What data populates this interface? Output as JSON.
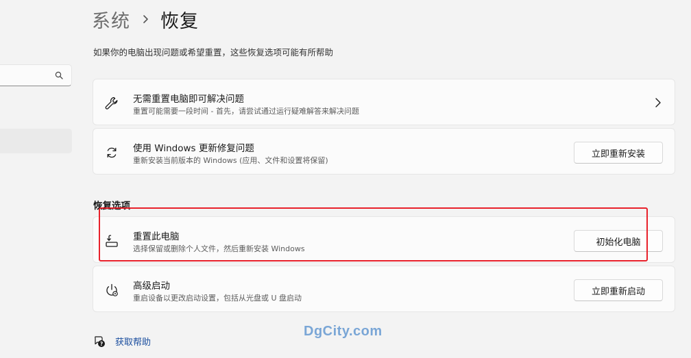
{
  "sidebar": {
    "search": {
      "value": "",
      "placeholder": ""
    },
    "selected_item": ""
  },
  "breadcrumb": {
    "parent": "系统",
    "separator": "›",
    "current": "恢复"
  },
  "page_description": "如果你的电脑出现问题或希望重置，这些恢复选项可能有所帮助",
  "cards_top": [
    {
      "title": "无需重置电脑即可解决问题",
      "subtitle": "重置可能需要一段时间 - 首先，请尝试通过运行疑难解答来解决问题",
      "icon": "wrench-icon",
      "action": "chevron-right"
    },
    {
      "title": "使用 Windows 更新修复问题",
      "subtitle": "重新安装当前版本的 Windows (应用、文件和设置将保留)",
      "icon": "refresh-icon",
      "button": "立即重新安装"
    }
  ],
  "recovery_section": {
    "label": "恢复选项",
    "items": [
      {
        "title": "重置此电脑",
        "subtitle": "选择保留或删除个人文件，然后重新安装 Windows",
        "icon": "reset-pc-icon",
        "button": "初始化电脑",
        "highlighted": true
      },
      {
        "title": "高级启动",
        "subtitle": "重启设备以更改启动设置，包括从光盘或 U 盘启动",
        "icon": "advanced-startup-icon",
        "button": "立即重新启动"
      }
    ]
  },
  "help": {
    "label": "获取帮助",
    "icon": "help-icon"
  },
  "watermark": "DgCity.com",
  "colors": {
    "background": "#f3f3f3",
    "card": "#fbfbfb",
    "highlight": "#e8202a",
    "link": "#1a4d9e",
    "watermark": "#7aa6d6"
  }
}
